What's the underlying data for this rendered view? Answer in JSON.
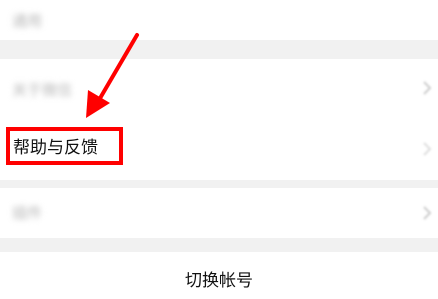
{
  "settings": {
    "items": [
      {
        "label": "通用"
      },
      {
        "label": "关于微信"
      },
      {
        "label": "帮助与反馈"
      },
      {
        "label": "插件"
      }
    ],
    "switch_account_label": "切换帐号"
  },
  "annotation": {
    "color": "#ff0000"
  }
}
